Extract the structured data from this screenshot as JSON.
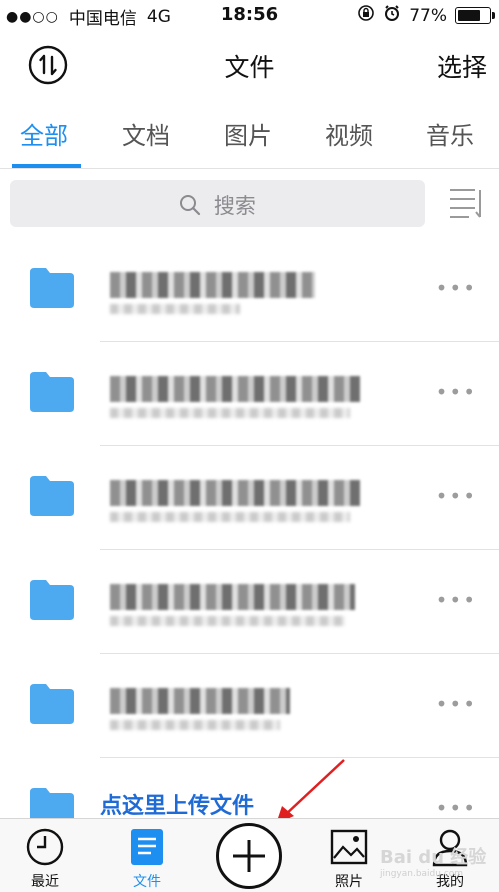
{
  "status_bar": {
    "signal": "●●○○",
    "carrier": "中国电信",
    "network": "4G",
    "time": "18:56",
    "battery": "77%",
    "battery_level": 0.77
  },
  "header": {
    "title": "文件",
    "select_label": "选择"
  },
  "tabs": [
    {
      "label": "全部",
      "active": true
    },
    {
      "label": "文档",
      "active": false
    },
    {
      "label": "图片",
      "active": false
    },
    {
      "label": "视频",
      "active": false
    },
    {
      "label": "音乐",
      "active": false
    }
  ],
  "search": {
    "placeholder": "搜索"
  },
  "files": [
    {
      "name": "",
      "more": "•••"
    },
    {
      "name": "",
      "more": "•••"
    },
    {
      "name": "",
      "more": "•••"
    },
    {
      "name": "",
      "more": "•••"
    },
    {
      "name": "",
      "more": "•••"
    },
    {
      "name": "",
      "more": "•••"
    }
  ],
  "annotation": {
    "text": "点这里上传文件",
    "color": "#1f6bd6",
    "arrow_color": "#e02020"
  },
  "tabbar": {
    "recent": "最近",
    "files": "文件",
    "photos": "照片",
    "me": "我的"
  },
  "watermark": {
    "text": "Bai du 经验",
    "sub": "jingyan.baidu.com"
  },
  "colors": {
    "accent": "#1d8ff0",
    "folder": "#4eaaf0"
  }
}
